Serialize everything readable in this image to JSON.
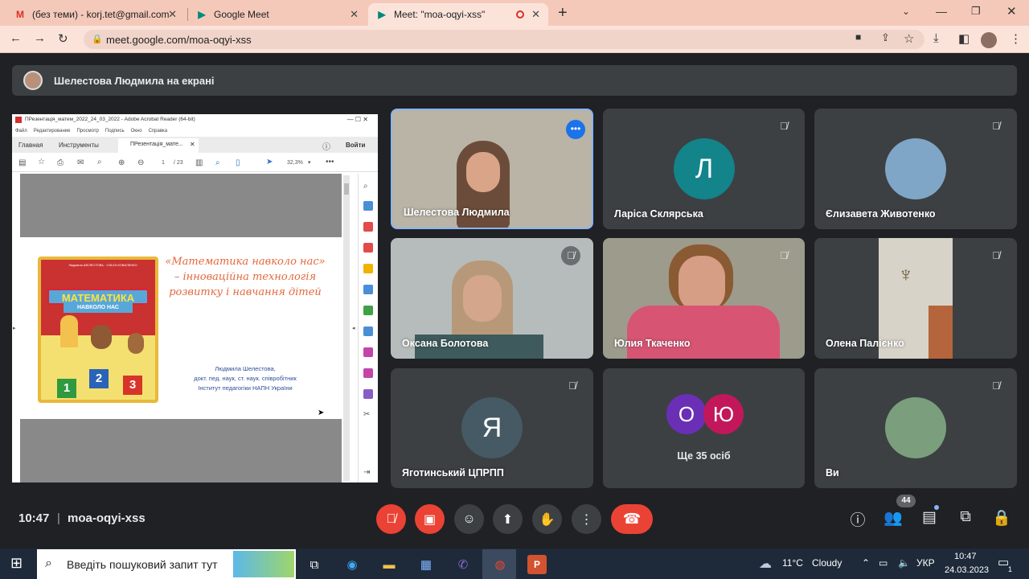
{
  "browser": {
    "tabs": [
      {
        "label": "(без теми) - korj.tet@gmail.com",
        "icon": "gmail-icon"
      },
      {
        "label": "Google Meet",
        "icon": "meet-icon"
      },
      {
        "label": "Meet: \"moa-oqyi-xss\"",
        "icon": "meet-icon"
      }
    ],
    "url": "meet.google.com/moa-oqyi-xss"
  },
  "meet": {
    "banner": "Шелестова Людмила на екрані",
    "time": "10:47",
    "separator": "|",
    "code": "moa-oqyi-xss",
    "participant_count": "44",
    "tiles": [
      {
        "name": "Шелестова Людмила"
      },
      {
        "name": "Ларіса Склярська",
        "initial": "Л"
      },
      {
        "name": "Єлизавета Животенко"
      },
      {
        "name": "Оксана Болотова"
      },
      {
        "name": "Юлия Ткаченко"
      },
      {
        "name": "Олена Палієнко"
      },
      {
        "name": "Яготинський ЦПРПП",
        "initial": "Я"
      },
      {
        "name": "Ще 35 осіб",
        "initials": [
          "О",
          "Ю"
        ]
      },
      {
        "name": "Ви"
      }
    ],
    "colors": {
      "accent_blue": "#8ab4f8",
      "red": "#ea4335",
      "tile_bg": "#3c4043"
    }
  },
  "presentation": {
    "window_title": "ПРезентація_матем_2022_24_03_2022 - Adobe Acrobat Reader (64-bit)",
    "menu": [
      "Файл",
      "Редактирование",
      "Просмотр",
      "Подпись",
      "Окно",
      "Справка"
    ],
    "tabs": [
      "Главная",
      "Инструменты",
      "ПРезентація_мате..."
    ],
    "signin": "Войти",
    "page_current": "1",
    "page_total": "/ 23",
    "zoom": "32,3%",
    "book_title": "МАТЕМАТИКА",
    "book_subtitle": "НАВКОЛО НАС",
    "book_authors": "Людмила ШЕЛЕСТОВА · ОЛЬГА КОВАЛЕНКО",
    "cubes": [
      "1",
      "2",
      "3"
    ],
    "slide_title": "«Математика навколо нас» – інноваційна технологія розвитку і навчання дітей",
    "author_lines": [
      "Людмила Шелестова,",
      "докт. пед. наук, ст. наук. співробітник",
      "Інститут педагогіки НАПН України"
    ]
  },
  "taskbar": {
    "search_placeholder": "Введіть пошуковий запит тут",
    "weather_temp": "11°C",
    "weather_text": "Cloudy",
    "lang": "УКР",
    "clock_time": "10:47",
    "clock_date": "24.03.2023",
    "notif_count": "1"
  }
}
